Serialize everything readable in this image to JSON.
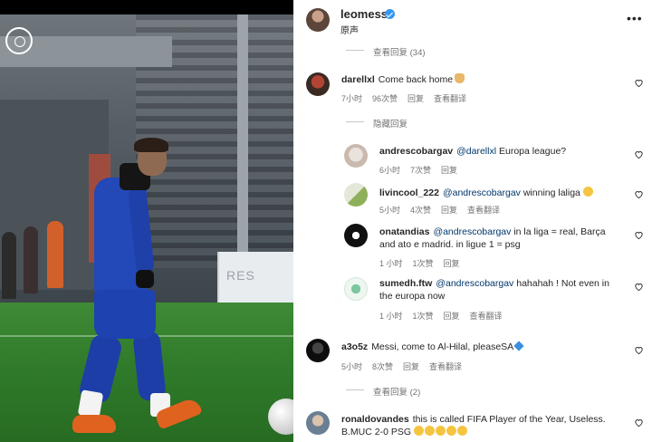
{
  "post": {
    "username": "leomessi",
    "subtitle": "原声"
  },
  "top_replies_toggle": "查看回复 (34)",
  "comments": [
    {
      "username": "darellxl",
      "text": "Come back home",
      "time": "7小时",
      "likes": "96次赞",
      "reply": "回复",
      "translate": "查看翻译",
      "replies_toggle": "隐藏回复",
      "replies": [
        {
          "username": "andrescobargav",
          "mention": "@darellxl",
          "text": "Europa league?",
          "time": "6小时",
          "likes": "7次赞",
          "reply": "回复"
        },
        {
          "username": "livincool_222",
          "mention": "@andrescobargav",
          "text": "winning laliga",
          "time": "5小时",
          "likes": "4次赞",
          "reply": "回复",
          "translate": "查看翻译"
        },
        {
          "username": "onatandias",
          "mention": "@andrescobargav",
          "text": "in la liga = real, Barça",
          "text2": "and ato e madrid. in ligue 1 = psg",
          "time": "1 小时",
          "likes": "1次赞",
          "reply": "回复"
        },
        {
          "username": "sumedh.ftw",
          "mention": "@andrescobargav",
          "text": "hahahah ! Not even in",
          "text2": "the europa now",
          "time": "1 小时",
          "likes": "1次赞",
          "reply": "回复",
          "translate": "查看翻译"
        }
      ]
    },
    {
      "username": "a3o5z",
      "text": "Messi, come to Al-Hilal, pleaseSA",
      "time": "5小时",
      "likes": "8次赞",
      "reply": "回复",
      "translate": "查看翻译",
      "replies_toggle": "查看回复 (2)"
    },
    {
      "username": "ronaldovandes",
      "text": "this is called FIFA Player of the Year, Useless.",
      "text2": "B.MUC 2-0 PSG"
    }
  ],
  "media": {
    "banner_text": "RES"
  },
  "colors": {
    "link": "#00376b",
    "meta": "#737373",
    "verified": "#3797f0"
  },
  "icons": [
    "more-icon",
    "verified-icon",
    "heart-icon",
    "folded-hands-emoji",
    "grinning-squint-emoji",
    "diamond-emoji"
  ]
}
